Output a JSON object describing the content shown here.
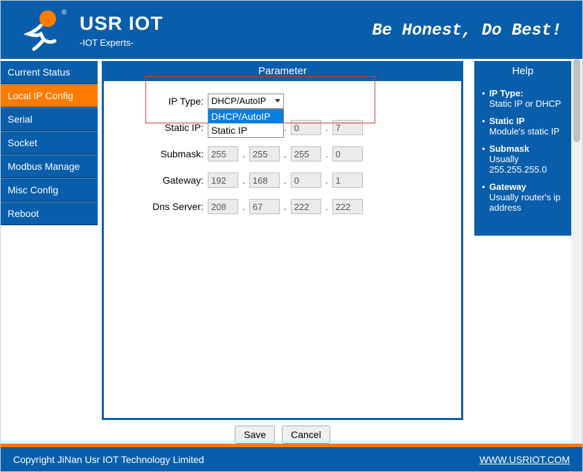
{
  "header": {
    "title": "USR IOT",
    "subtitle": "-IOT Experts-",
    "slogan": "Be Honest, Do Best!"
  },
  "sidebar": {
    "items": [
      {
        "label": "Current Status",
        "active": false
      },
      {
        "label": "Local IP Config",
        "active": true
      },
      {
        "label": "Serial",
        "active": false
      },
      {
        "label": "Socket",
        "active": false
      },
      {
        "label": "Modbus Manage",
        "active": false
      },
      {
        "label": "Misc Config",
        "active": false
      },
      {
        "label": "Reboot",
        "active": false
      }
    ]
  },
  "panel": {
    "title": "Parameter",
    "fields": {
      "ip_type": {
        "label": "IP Type:",
        "value": "DHCP/AutoIP",
        "options": [
          "DHCP/AutoIP",
          "Static IP"
        ],
        "selected_index": 0
      },
      "static_ip": {
        "label": "Static IP:",
        "parts": [
          "",
          "",
          "0",
          "7"
        ]
      },
      "submask": {
        "label": "Submask:",
        "parts": [
          "255",
          "255",
          "255",
          "0"
        ]
      },
      "gateway": {
        "label": "Gateway:",
        "parts": [
          "192",
          "168",
          "0",
          "1"
        ]
      },
      "dns": {
        "label": "Dns Server:",
        "parts": [
          "208",
          "67",
          "222",
          "222"
        ]
      }
    },
    "actions": {
      "save": "Save",
      "cancel": "Cancel"
    }
  },
  "help": {
    "title": "Help",
    "items": [
      {
        "term": "IP Type:",
        "desc": "Static IP or DHCP"
      },
      {
        "term": "Static IP",
        "desc": "Module's static IP"
      },
      {
        "term": "Submask",
        "desc": "Usually 255.255.255.0"
      },
      {
        "term": "Gateway",
        "desc": "Usually router's ip address"
      }
    ]
  },
  "footer": {
    "copyright": "Copyright JiNan Usr IOT Technology Limited",
    "link": "WWW.USRIOT.COM"
  }
}
